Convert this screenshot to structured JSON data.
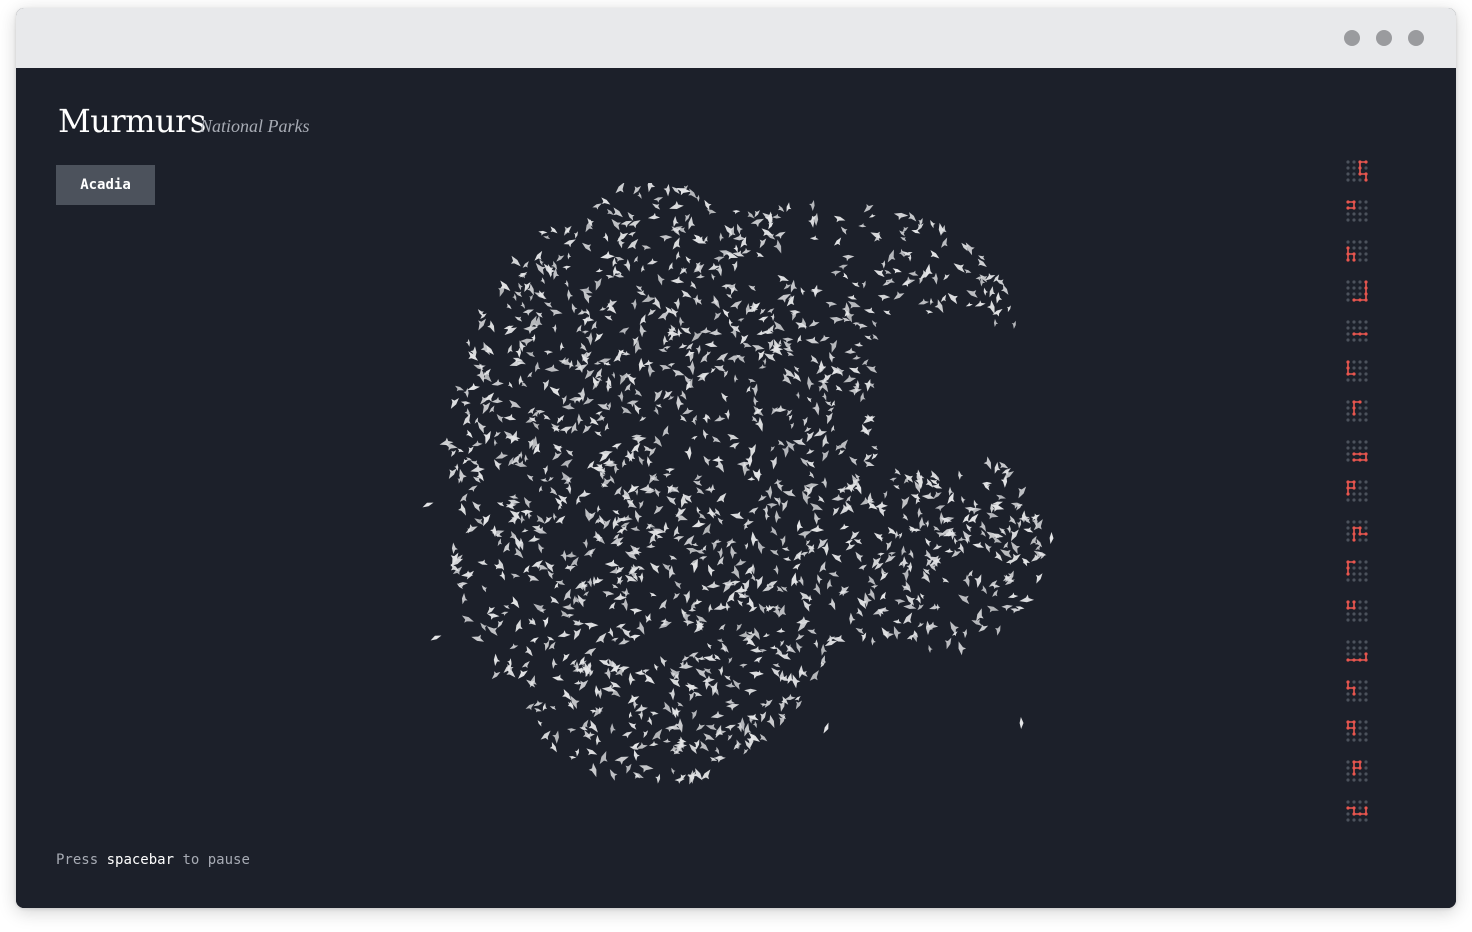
{
  "window": {
    "controls": [
      "window-dot",
      "window-dot",
      "window-dot"
    ]
  },
  "header": {
    "title": "Murmurs",
    "subtitle": "National Parks"
  },
  "park_button": {
    "label": "Acadia"
  },
  "hint": {
    "prefix": "Press",
    "key": "spacebar",
    "suffix": "to pause"
  },
  "colors": {
    "background": "#1c202a",
    "bird": "#e4e5e7",
    "accent": "#e8564f",
    "inactive_dot": "#4c525c",
    "button": "#4c525c"
  },
  "pattern_count": 17
}
